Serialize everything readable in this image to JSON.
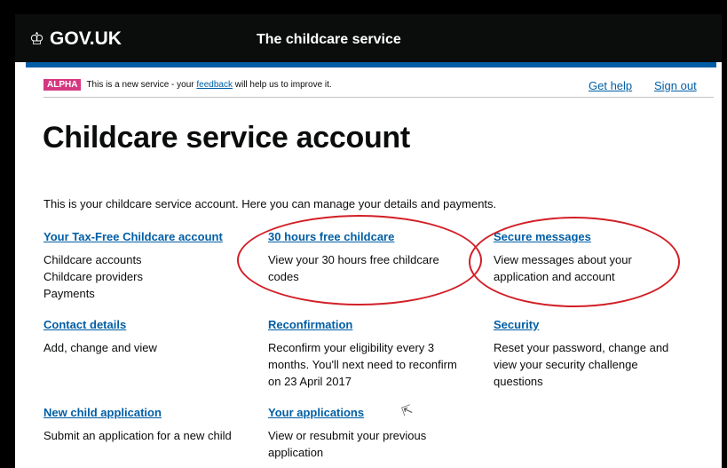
{
  "header": {
    "logo_text": "GOV.UK",
    "service_name": "The childcare service"
  },
  "phase_banner": {
    "tag": "ALPHA",
    "text_before": "This is a new service - your ",
    "feedback_link": "feedback",
    "text_after": " will help us to improve it."
  },
  "top_links": {
    "help": "Get help",
    "sign_out": "Sign out"
  },
  "page": {
    "title": "Childcare service account",
    "intro": "This is your childcare service account. Here you can manage your details and payments."
  },
  "cards": [
    {
      "link": "Your Tax-Free Childcare account",
      "lines": [
        "Childcare accounts",
        "Childcare providers",
        "Payments"
      ]
    },
    {
      "link": "30 hours free childcare",
      "desc": "View your 30 hours free childcare codes"
    },
    {
      "link": "Secure messages",
      "desc": "View messages about your application and account"
    },
    {
      "link": "Contact details",
      "desc": "Add, change and view"
    },
    {
      "link": "Reconfirmation",
      "desc": "Reconfirm your eligibility every 3 months. You'll next need to reconfirm on 23 April 2017"
    },
    {
      "link": "Security",
      "desc": "Reset your password, change and view your security challenge questions"
    },
    {
      "link": "New child application",
      "desc": "Submit an application for a new child"
    },
    {
      "link": "Your applications",
      "desc": "View or resubmit your previous application"
    }
  ],
  "colors": {
    "header_bg": "#0b0c0c",
    "accent_bar": "#005ea5",
    "link": "#005ea5",
    "alpha_tag": "#d53880",
    "annotation_ring": "#d21f26"
  }
}
